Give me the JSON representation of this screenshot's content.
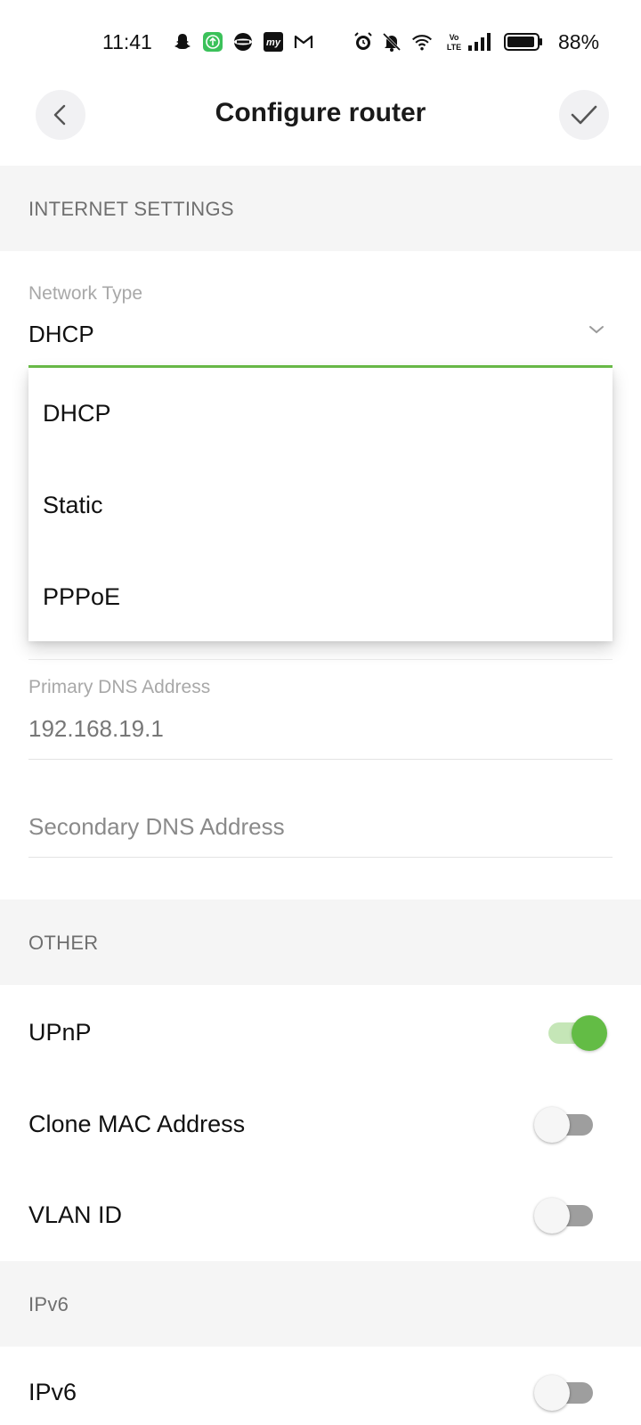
{
  "status_bar": {
    "time": "11:41",
    "battery_percent": "88%",
    "icons": [
      "snapchat-icon",
      "upload-app-icon",
      "browser-app-icon",
      "mj-app-icon",
      "gmail-icon",
      "alarm-icon",
      "mute-icon",
      "wifi-icon",
      "volte-icon",
      "signal-icon",
      "battery-icon"
    ]
  },
  "header": {
    "title": "Configure router",
    "back_icon": "chevron-left-icon",
    "confirm_icon": "check-icon"
  },
  "sections": {
    "internet": "INTERNET SETTINGS",
    "other": "OTHER",
    "ipv6": "IPv6"
  },
  "network_type": {
    "label": "Network Type",
    "value": "DHCP",
    "options": [
      "DHCP",
      "Static",
      "PPPoE"
    ]
  },
  "dns": {
    "primary_label": "Primary DNS Address",
    "primary_value": "192.168.19.1",
    "secondary_placeholder": "Secondary DNS Address"
  },
  "other": {
    "upnp": {
      "label": "UPnP",
      "on": true
    },
    "clone_mac": {
      "label": "Clone MAC Address",
      "on": false
    },
    "vlan": {
      "label": "VLAN ID",
      "on": false
    }
  },
  "ipv6": {
    "toggle": {
      "label": "IPv6",
      "on": false
    }
  },
  "colors": {
    "accent": "#6cbf4a",
    "toggle_on_knob": "#63bc45",
    "toggle_on_track": "#c5e6b7",
    "toggle_off_track": "#9e9e9e",
    "section_bg": "#f5f5f5"
  }
}
